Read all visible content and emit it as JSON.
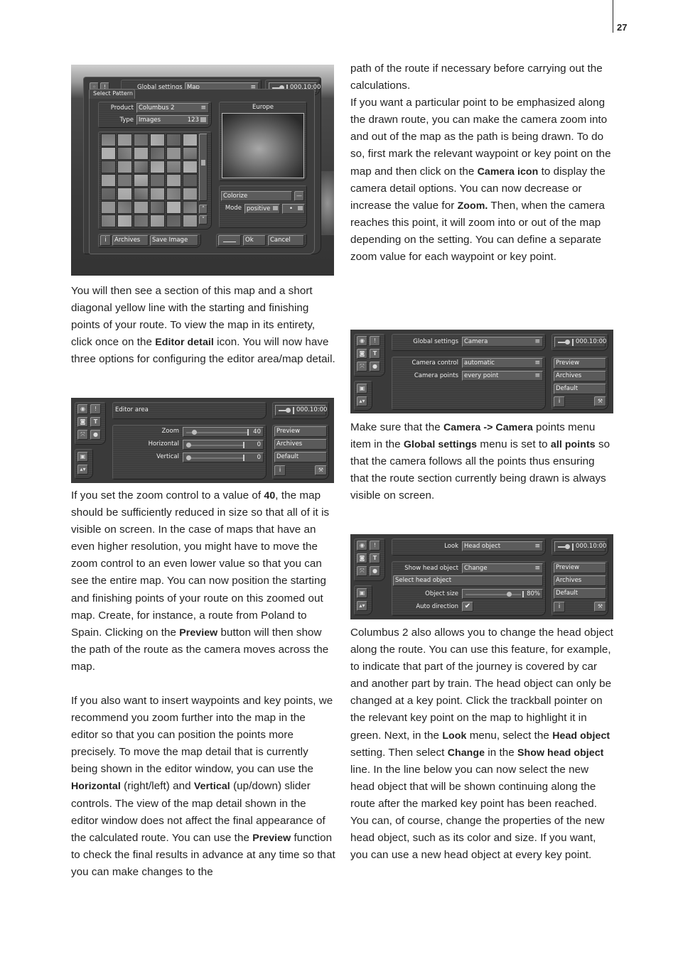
{
  "page": {
    "number": "27"
  },
  "left_column": {
    "para1": [
      {
        "t": "You will then see a section of this map and a short diagonal yellow line with the starting and finishing points of your route. To view the map in its entirety, click once on the "
      },
      {
        "b": "Editor detail"
      },
      {
        "t": " icon. You will now have three options for configuring the editor area/map detail."
      }
    ],
    "para2": [
      {
        "t": "If you set the zoom control to a value of "
      },
      {
        "b": "40"
      },
      {
        "t": ", the map should be sufficiently reduced in size so that all of it is visible on screen. In the case of maps that have an even higher resolution, you might have to move the zoom control to an even lower value so that you can see the entire map. You can now position the starting and finishing points of your route on this zoomed out map. Create, for instance, a route from Poland to Spain. Clicking on the "
      },
      {
        "b": "Preview"
      },
      {
        "t": " button will then show the path of the route as the camera moves across the map."
      }
    ],
    "para3": [
      {
        "t": "If you also want to insert waypoints and key points, we recommend you zoom further into the map in the editor so that you can position the points more precisely. To move the map detail that is currently being shown in the editor window, you can use the "
      },
      {
        "b": "Horizontal"
      },
      {
        "t": " (right/left) and "
      },
      {
        "b": "Vertical"
      },
      {
        "t": " (up/down) slider controls. The view of the map detail shown in the editor window does not affect the final appearance of the calculated route. You can use the "
      },
      {
        "b": "Preview"
      },
      {
        "t": " function to check the final results in advance at any time so that you can make changes to the"
      }
    ]
  },
  "right_column": {
    "para1": [
      {
        "t": "path of the route if necessary before carrying out the calculations."
      }
    ],
    "para2": [
      {
        "t": "If you want a particular point to be emphasized along the drawn route, you can make the camera zoom into and out of the map as the path is being drawn. To do so, first mark the relevant waypoint or key point on the map and then click on the "
      },
      {
        "b": "Camera icon"
      },
      {
        "t": " to display the camera detail options. You can now decrease or increase the value for "
      },
      {
        "b": "Zoom."
      },
      {
        "t": " Then, when the camera reaches this point, it will zoom into or out of the map depending on the setting. You can define a separate zoom value for each waypoint or key point."
      }
    ],
    "para3": [
      {
        "t": "Make sure that the "
      },
      {
        "b": "Camera ->  Camera"
      },
      {
        "t": " points menu item in the "
      },
      {
        "b": "Global settings"
      },
      {
        "t": " menu is set to "
      },
      {
        "b": "all points"
      },
      {
        "t": " so that the camera follows all the points thus ensuring that the route section currently being drawn is always visible on screen."
      }
    ],
    "para4": [
      {
        "t": "Columbus 2 also allows you to change the head object along the route. You can use this feature, for example, to indicate that part of the journey is covered by car and another part by train. The head object can only be changed at a key point. Click the trackball pointer on the relevant key point on the map to highlight it in green. Next, in the "
      },
      {
        "b": "Look"
      },
      {
        "t": " menu, select the "
      },
      {
        "b": "Head object"
      },
      {
        "t": " setting. Then select "
      },
      {
        "b": "Change"
      },
      {
        "t": " in the "
      },
      {
        "b": "Show head object"
      },
      {
        "t": " line. In the line below you can now select the new head object that will be shown continuing along the route after the marked key point has been reached. You can, of course, change the properties of the new head object, such as its color and size. If you want, you can use a new head object at every key point."
      }
    ]
  },
  "screens": {
    "select_pattern": {
      "global_settings_label": "Global settings",
      "global_settings_value": "Map",
      "time": "000.10:00",
      "dialog_title": "Select Pattern",
      "product_label": "Product",
      "product_value": "Columbus 2",
      "type_label": "Type",
      "type_value": "Images",
      "type_count": "123",
      "preview_title": "Europe",
      "colorize_label": "Colorize",
      "mode_label": "Mode",
      "mode_value": "positive",
      "mode_extra": "•",
      "info_button": "i",
      "archives_button": "Archives",
      "save_image_button": "Save Image",
      "ok_button": "Ok",
      "cancel_button": "Cancel",
      "scroll_up": "˄",
      "scroll_down": "˅"
    },
    "editor_area": {
      "title": "Editor area",
      "time": "000.10:00",
      "sliders": [
        {
          "label": "Zoom",
          "value": "40",
          "fraction": 0.1
        },
        {
          "label": "Horizontal",
          "value": "0",
          "fraction": 0.0
        },
        {
          "label": "Vertical",
          "value": "0",
          "fraction": 0.0
        }
      ],
      "side_buttons": [
        "Preview",
        "Archives",
        "Default"
      ],
      "info_button": "i"
    },
    "camera": {
      "global_settings_label": "Global settings",
      "global_settings_value": "Camera",
      "time": "000.10:00",
      "rows": [
        {
          "label": "Camera control",
          "value": "automatic"
        },
        {
          "label": "Camera points",
          "value": "every point"
        }
      ],
      "side_buttons": [
        "Preview",
        "Archives",
        "Default"
      ],
      "info_button": "i"
    },
    "head_object": {
      "look_label": "Look",
      "look_value": "Head object",
      "time": "000.10:00",
      "show_label": "Show head object",
      "show_value": "Change",
      "select_button": "Select head object",
      "size_label": "Object size",
      "size_value": "80%",
      "size_fraction": 0.8,
      "auto_label": "Auto direction",
      "auto_checked": "✔",
      "side_buttons": [
        "Preview",
        "Archives",
        "Default"
      ],
      "info_button": "i"
    }
  }
}
